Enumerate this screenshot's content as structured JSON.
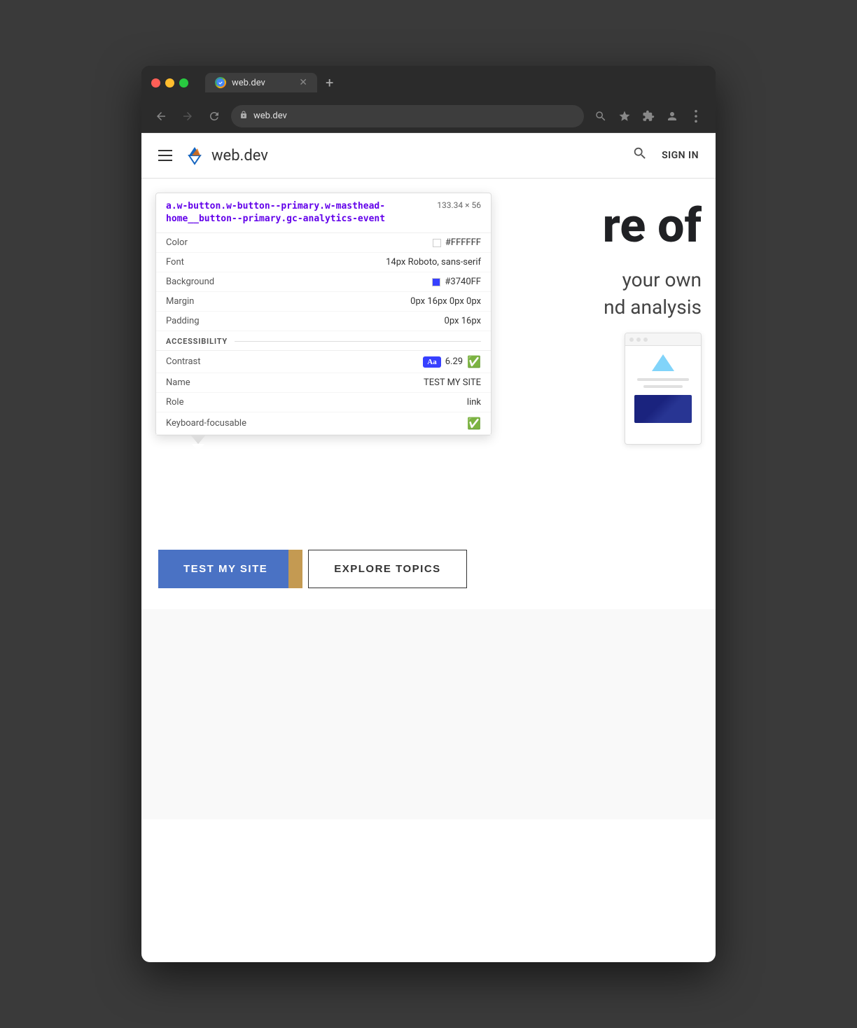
{
  "browser": {
    "titlebar": {
      "tab_title": "web.dev",
      "tab_favicon_label": "W",
      "close_label": "✕",
      "new_tab_label": "+"
    },
    "navbar": {
      "back_label": "←",
      "forward_label": "→",
      "reload_label": "↻",
      "address": "web.dev",
      "zoom_label": "⊕",
      "bookmark_label": "☆",
      "extensions_label": "🧩",
      "account_label": "⊙",
      "menu_label": "⋮"
    }
  },
  "site_header": {
    "hamburger_label": "☰",
    "logo_text": "web.dev",
    "search_label": "🔍",
    "sign_in_label": "SIGN IN"
  },
  "hero": {
    "text_partial_line1": "re of",
    "text_partial_line2": "",
    "sub_text_line1": "your own",
    "sub_text_line2": "nd analysis"
  },
  "inspector": {
    "selector": "a.w-button.w-button--primary.w-masthead-home__button--primary.gc-analytics-event",
    "dimensions": "133.34 × 56",
    "properties": [
      {
        "label": "Color",
        "value": "#FFFFFF",
        "swatch": "white"
      },
      {
        "label": "Font",
        "value": "14px Roboto, sans-serif"
      },
      {
        "label": "Background",
        "value": "#3740FF",
        "swatch": "blue"
      },
      {
        "label": "Margin",
        "value": "0px 16px 0px 0px"
      },
      {
        "label": "Padding",
        "value": "0px 16px"
      }
    ],
    "accessibility_label": "ACCESSIBILITY",
    "accessibility": [
      {
        "label": "Contrast",
        "badge": "Aa",
        "value": "6.29",
        "check": true
      },
      {
        "label": "Name",
        "value": "TEST MY SITE"
      },
      {
        "label": "Role",
        "value": "link"
      },
      {
        "label": "Keyboard-focusable",
        "check": true
      }
    ]
  },
  "buttons": {
    "test_my_site_label": "TEST MY SITE",
    "explore_topics_label": "EXPLORE TOPICS"
  }
}
